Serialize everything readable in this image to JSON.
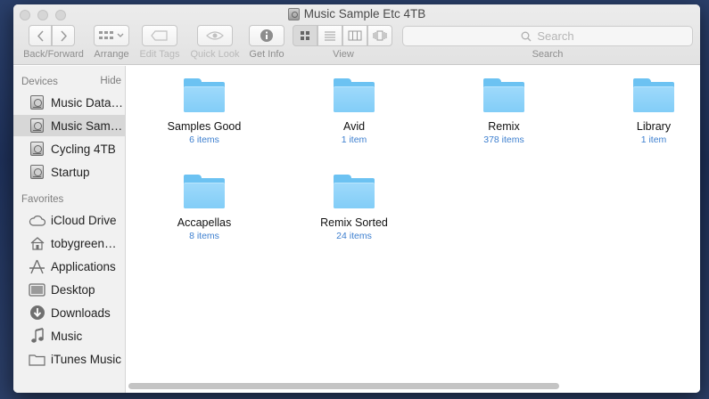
{
  "window": {
    "title": "Music Sample Etc 4TB"
  },
  "toolbar": {
    "back_forward_label": "Back/Forward",
    "arrange_label": "Arrange",
    "edit_tags_label": "Edit Tags",
    "quick_look_label": "Quick Look",
    "get_info_label": "Get Info",
    "view_label": "View",
    "search_label": "Search",
    "search_placeholder": "Search"
  },
  "sidebar": {
    "devices_header": "Devices",
    "hide_label": "Hide",
    "devices": [
      {
        "label": "Music Data…",
        "icon": "hard-drive-icon"
      },
      {
        "label": "Music Sam…",
        "icon": "hard-drive-icon",
        "selected": true
      },
      {
        "label": "Cycling 4TB",
        "icon": "hard-drive-icon"
      },
      {
        "label": "Startup",
        "icon": "hard-drive-icon"
      }
    ],
    "favorites_header": "Favorites",
    "favorites": [
      {
        "label": "iCloud Drive",
        "icon": "cloud-icon"
      },
      {
        "label": "tobygreen…",
        "icon": "home-icon"
      },
      {
        "label": "Applications",
        "icon": "applications-icon"
      },
      {
        "label": "Desktop",
        "icon": "desktop-icon"
      },
      {
        "label": "Downloads",
        "icon": "downloads-icon"
      },
      {
        "label": "Music",
        "icon": "music-note-icon"
      },
      {
        "label": "iTunes Music",
        "icon": "folder-icon"
      }
    ]
  },
  "items": [
    {
      "name": "Samples Good",
      "count": "6 items"
    },
    {
      "name": "Avid",
      "count": "1 item"
    },
    {
      "name": "Remix",
      "count": "378 items"
    },
    {
      "name": "Library",
      "count": "1 item"
    },
    {
      "name": "Accapellas",
      "count": "8 items"
    },
    {
      "name": "Remix Sorted",
      "count": "24 items"
    }
  ],
  "colors": {
    "folder": "#82cdf7",
    "count_text": "#3d7fcf",
    "sidebar_bg": "#f1f1f1",
    "selected_row": "#d7d7d7"
  }
}
